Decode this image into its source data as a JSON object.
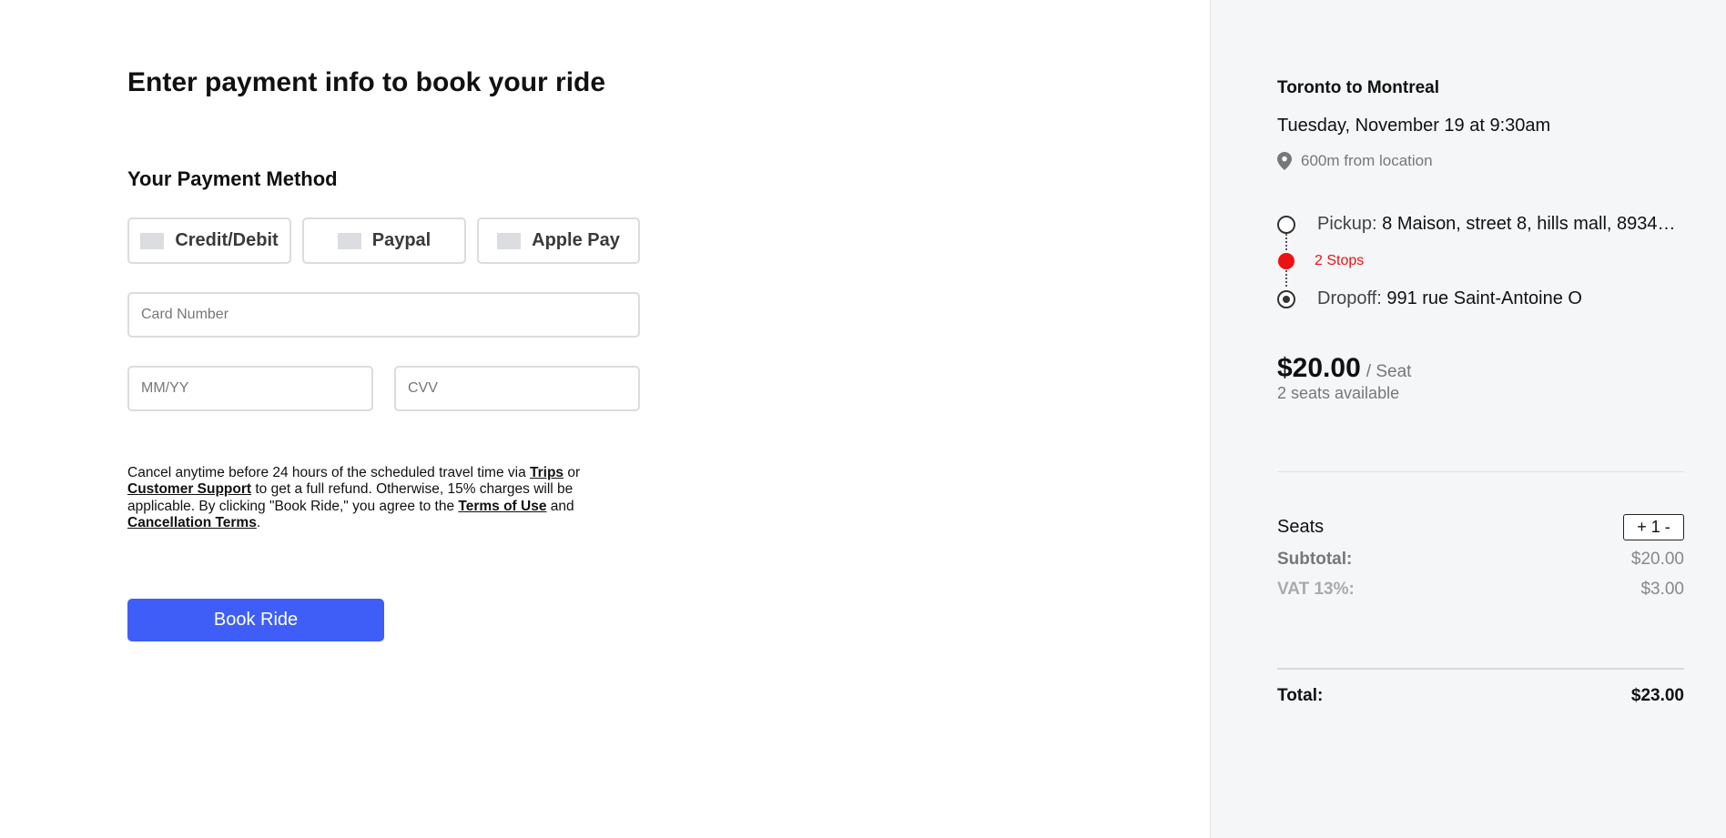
{
  "payment": {
    "title": "Enter payment info to book your ride",
    "section_title": "Your Payment Method",
    "methods": [
      {
        "label": "Credit/Debit"
      },
      {
        "label": "Paypal"
      },
      {
        "label": "Apple Pay"
      }
    ],
    "card_number": {
      "value": "",
      "placeholder": "Card Number"
    },
    "expiry": {
      "value": "",
      "placeholder": "MM/YY"
    },
    "cvv": {
      "value": "",
      "placeholder": "CVV"
    },
    "terms": {
      "t1": "Cancel anytime before 24 hours of the scheduled travel time via ",
      "link_trips": "Trips",
      "t2": " or ",
      "link_support": "Customer Support",
      "t3": " to get a full refund. Otherwise, 15% charges will be applicable. By clicking \"Book Ride,\" you agree to the ",
      "link_terms": "Terms of Use",
      "t4": " and ",
      "link_cancellation": "Cancellation Terms",
      "t5": "."
    },
    "book_button": "Book Ride"
  },
  "summary": {
    "trip_title": "Toronto to Montreal",
    "date": "Tuesday, November 19 at 9:30am",
    "distance": "600m from location",
    "pickup_label": "Pickup:",
    "pickup_address": "8 Maison, street 8, hills mall, 8934…",
    "stops": "2 Stops",
    "dropoff_label": "Dropoff:",
    "dropoff_address": "991 rue Saint-Antoine O",
    "price": "$20.00",
    "price_unit": "/ Seat",
    "availability": "2 seats available",
    "seats_label": "Seats",
    "seats_stepper": "+ 1 -",
    "subtotal_label": "Subtotal:",
    "subtotal_value": "$20.00",
    "vat_label": "VAT 13%:",
    "vat_value": "$3.00",
    "total_label": "Total:",
    "total_value": "$23.00"
  },
  "colors": {
    "primary_button": "#3f5ef7",
    "stops_red": "#ee1111",
    "sidebar_bg": "#f5f6f8"
  },
  "icons": {
    "location": "map-pin-icon",
    "pickup": "circle-outline-icon",
    "stops": "red-dot-icon",
    "dropoff": "target-icon"
  }
}
